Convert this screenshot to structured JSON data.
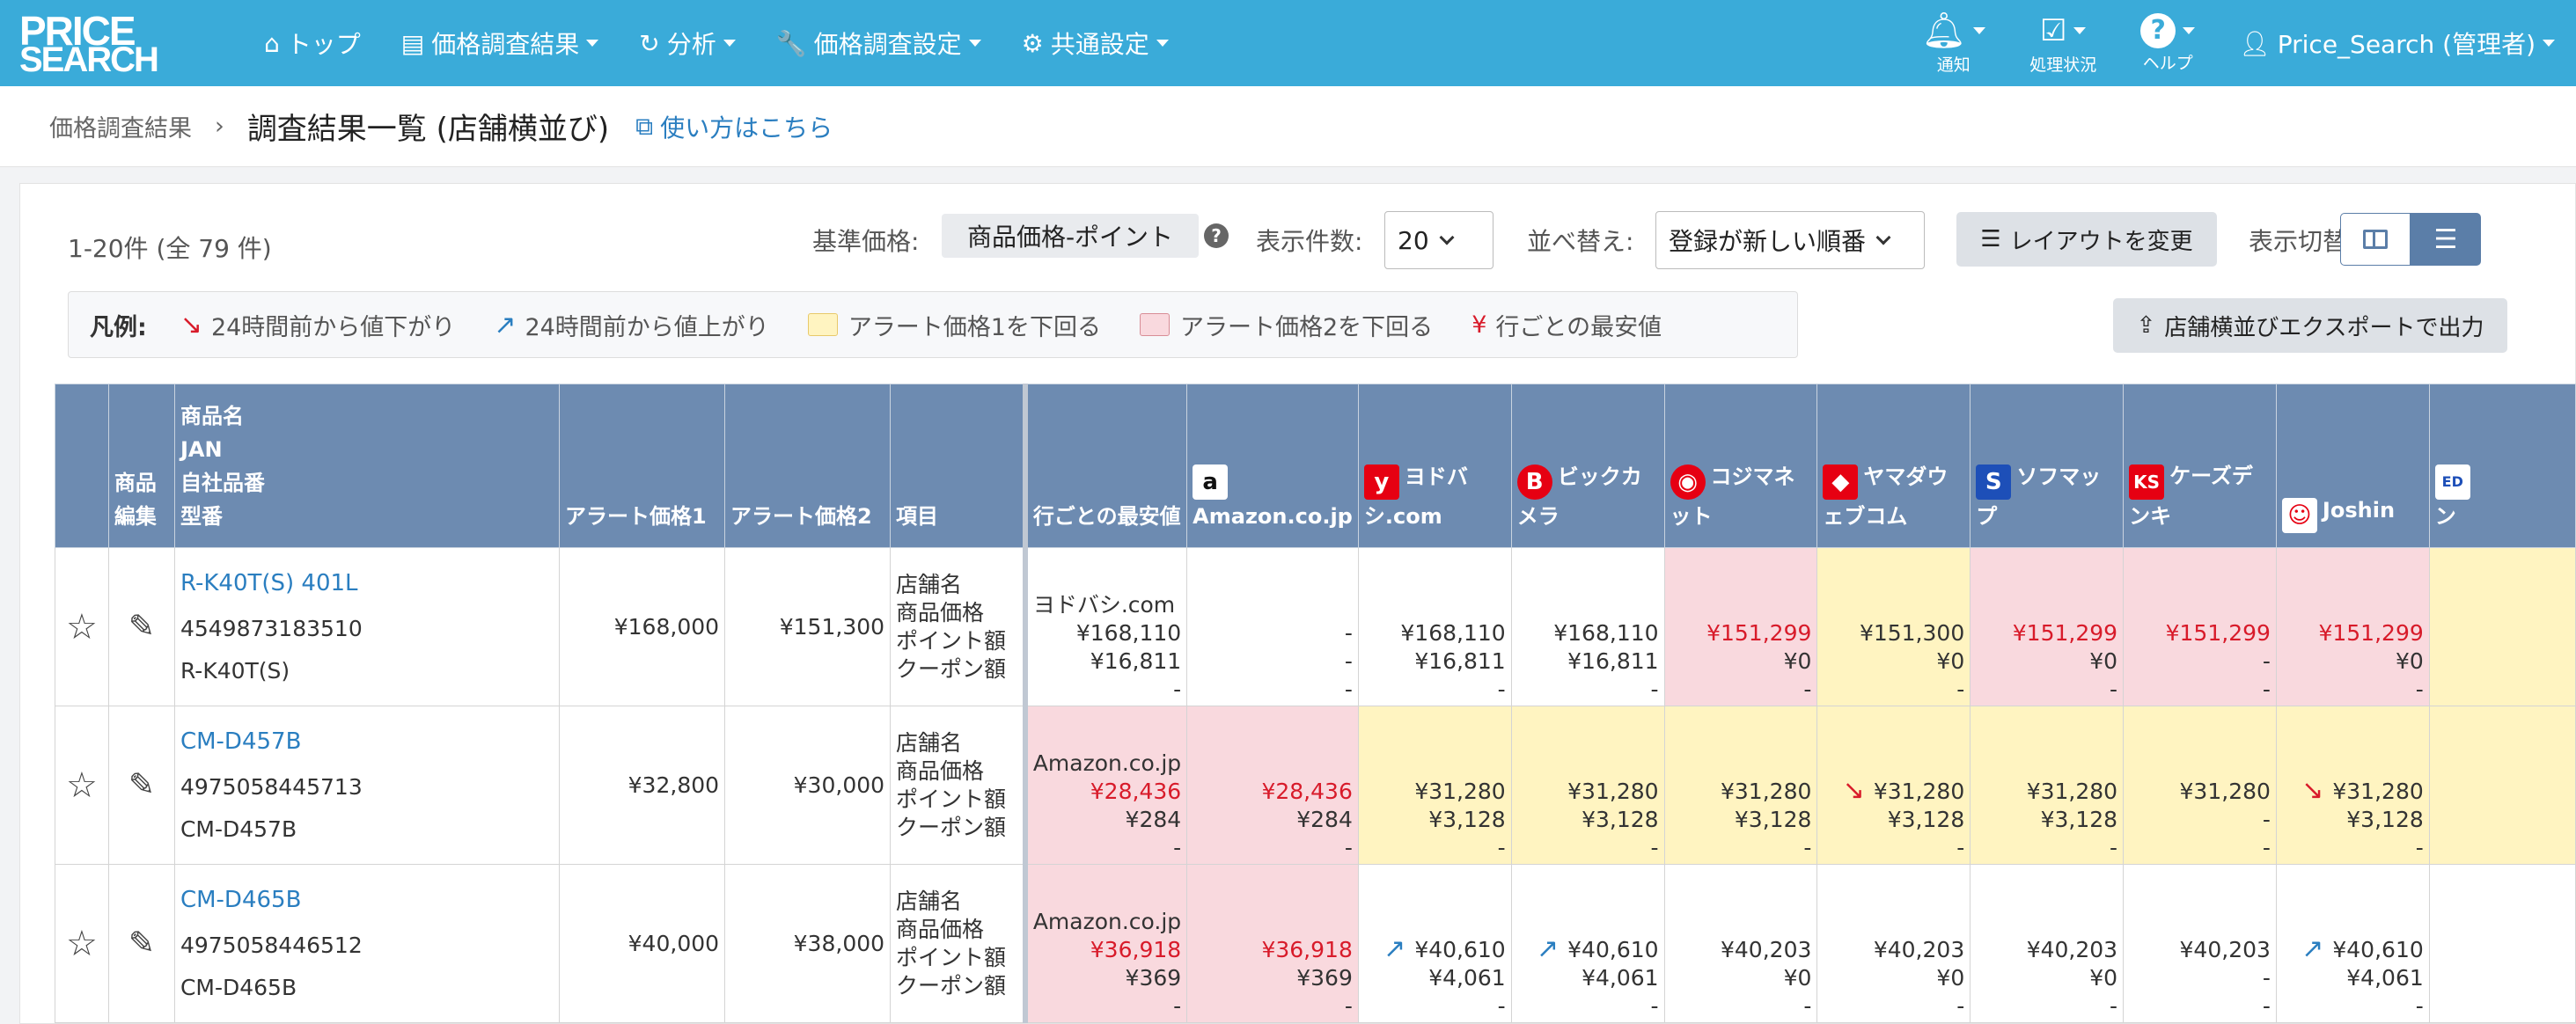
{
  "nav": {
    "logo_top": "PRICE",
    "logo_bottom": "SEARCH",
    "menu": [
      {
        "label": "トップ",
        "icon": "home-icon"
      },
      {
        "label": "価格調査結果",
        "icon": "list-icon"
      },
      {
        "label": "分析",
        "icon": "refresh-icon"
      },
      {
        "label": "価格調査設定",
        "icon": "wrench-icon"
      },
      {
        "label": "共通設定",
        "icon": "gear-icon"
      }
    ],
    "right": [
      {
        "label": "通知",
        "icon": "bell-icon"
      },
      {
        "label": "処理状況",
        "icon": "checklist-icon"
      },
      {
        "label": "ヘルプ",
        "icon": "help-icon"
      }
    ],
    "user": "Price_Search (管理者)"
  },
  "breadcrumb": {
    "parent": "価格調査結果",
    "current": "調査結果一覧 (店舗横並び)",
    "help_link": "使い方はこちら"
  },
  "toolbar": {
    "count": "1-20件 (全 79 件)",
    "base_price_label": "基準価格:",
    "base_price_value": "商品価格-ポイント",
    "per_page_label": "表示件数:",
    "per_page_value": "20",
    "sort_label": "並べ替え:",
    "sort_value": "登録が新しい順番",
    "layout_button": "レイアウトを変更",
    "view_toggle_label": "表示切替",
    "export_button": "店舗横並びエクスポートで出力"
  },
  "legend": {
    "title": "凡例:",
    "items": [
      "24時間前から値下がり",
      "24時間前から値上がり",
      "アラート価格1を下回る",
      "アラート価格2を下回る",
      "行ごとの最安値"
    ],
    "yen_symbol": "¥"
  },
  "colors": {
    "nav": "#3aabd9",
    "header": "#6d8bb1",
    "alert1": "#fff4c1",
    "alert2": "#f9d9de",
    "lowest": "#d81b2a"
  },
  "table": {
    "headers": {
      "edit": "商品\n編集",
      "product": "商品名\nJAN\n自社品番\n型番",
      "alert1": "アラート価格1",
      "alert2": "アラート価格2",
      "item": "項目",
      "best": "行ごとの最安値",
      "shops": [
        "Amazon.co.jp",
        "ヨドバシ.com",
        "ビックカメラ",
        "コジマネット",
        "ヤマダウェブコム",
        "ソフマップ",
        "ケーズデンキ",
        "Joshin",
        "ン"
      ]
    },
    "item_labels": [
      "店舗名",
      "商品価格",
      "ポイント額",
      "クーポン額"
    ],
    "rows": [
      {
        "name": "R-K40T(S) 401L",
        "jan": "4549873183510",
        "model": "R-K40T(S)",
        "alert1": "¥168,000",
        "alert2": "¥151,300",
        "best": {
          "shop": "ヨドバシ.com",
          "price": "¥168,110",
          "point": "¥16,811",
          "coupon": "-",
          "bg": "",
          "red": false
        },
        "cells": [
          {
            "price": "-",
            "point": "-",
            "coupon": "-",
            "bg": "",
            "red": false,
            "arrow": ""
          },
          {
            "price": "¥168,110",
            "point": "¥16,811",
            "coupon": "-",
            "bg": "",
            "red": false,
            "arrow": ""
          },
          {
            "price": "¥168,110",
            "point": "¥16,811",
            "coupon": "-",
            "bg": "",
            "red": false,
            "arrow": ""
          },
          {
            "price": "¥151,299",
            "point": "¥0",
            "coupon": "-",
            "bg": "pink",
            "red": true,
            "arrow": ""
          },
          {
            "price": "¥151,300",
            "point": "¥0",
            "coupon": "-",
            "bg": "yel",
            "red": false,
            "arrow": ""
          },
          {
            "price": "¥151,299",
            "point": "¥0",
            "coupon": "-",
            "bg": "pink",
            "red": true,
            "arrow": ""
          },
          {
            "price": "¥151,299",
            "point": "-",
            "coupon": "-",
            "bg": "pink",
            "red": true,
            "arrow": ""
          },
          {
            "price": "¥151,299",
            "point": "¥0",
            "coupon": "-",
            "bg": "pink",
            "red": true,
            "arrow": ""
          },
          {
            "price": "",
            "point": "",
            "coupon": "",
            "bg": "yel",
            "red": false,
            "arrow": ""
          }
        ]
      },
      {
        "name": "CM-D457B",
        "jan": "4975058445713",
        "model": "CM-D457B",
        "alert1": "¥32,800",
        "alert2": "¥30,000",
        "best": {
          "shop": "Amazon.co.jp",
          "price": "¥28,436",
          "point": "¥284",
          "coupon": "-",
          "bg": "pink",
          "red": true
        },
        "cells": [
          {
            "price": "¥28,436",
            "point": "¥284",
            "coupon": "-",
            "bg": "pink",
            "red": true,
            "arrow": ""
          },
          {
            "price": "¥31,280",
            "point": "¥3,128",
            "coupon": "-",
            "bg": "yel",
            "red": false,
            "arrow": ""
          },
          {
            "price": "¥31,280",
            "point": "¥3,128",
            "coupon": "-",
            "bg": "yel",
            "red": false,
            "arrow": ""
          },
          {
            "price": "¥31,280",
            "point": "¥3,128",
            "coupon": "-",
            "bg": "yel",
            "red": false,
            "arrow": ""
          },
          {
            "price": "¥31,280",
            "point": "¥3,128",
            "coupon": "-",
            "bg": "yel",
            "red": false,
            "arrow": "down"
          },
          {
            "price": "¥31,280",
            "point": "¥3,128",
            "coupon": "-",
            "bg": "yel",
            "red": false,
            "arrow": ""
          },
          {
            "price": "¥31,280",
            "point": "-",
            "coupon": "-",
            "bg": "yel",
            "red": false,
            "arrow": ""
          },
          {
            "price": "¥31,280",
            "point": "¥3,128",
            "coupon": "-",
            "bg": "yel",
            "red": false,
            "arrow": "down"
          },
          {
            "price": "",
            "point": "",
            "coupon": "",
            "bg": "yel",
            "red": false,
            "arrow": ""
          }
        ]
      },
      {
        "name": "CM-D465B",
        "jan": "4975058446512",
        "model": "CM-D465B",
        "alert1": "¥40,000",
        "alert2": "¥38,000",
        "best": {
          "shop": "Amazon.co.jp",
          "price": "¥36,918",
          "point": "¥369",
          "coupon": "-",
          "bg": "pink",
          "red": true
        },
        "cells": [
          {
            "price": "¥36,918",
            "point": "¥369",
            "coupon": "-",
            "bg": "pink",
            "red": true,
            "arrow": ""
          },
          {
            "price": "¥40,610",
            "point": "¥4,061",
            "coupon": "-",
            "bg": "",
            "red": false,
            "arrow": "up"
          },
          {
            "price": "¥40,610",
            "point": "¥4,061",
            "coupon": "-",
            "bg": "",
            "red": false,
            "arrow": "up"
          },
          {
            "price": "¥40,203",
            "point": "¥0",
            "coupon": "-",
            "bg": "",
            "red": false,
            "arrow": ""
          },
          {
            "price": "¥40,203",
            "point": "¥0",
            "coupon": "-",
            "bg": "",
            "red": false,
            "arrow": ""
          },
          {
            "price": "¥40,203",
            "point": "¥0",
            "coupon": "-",
            "bg": "",
            "red": false,
            "arrow": ""
          },
          {
            "price": "¥40,203",
            "point": "-",
            "coupon": "-",
            "bg": "",
            "red": false,
            "arrow": ""
          },
          {
            "price": "¥40,610",
            "point": "¥4,061",
            "coupon": "-",
            "bg": "",
            "red": false,
            "arrow": "up"
          },
          {
            "price": "",
            "point": "",
            "coupon": "",
            "bg": "",
            "red": false,
            "arrow": ""
          }
        ]
      }
    ]
  }
}
